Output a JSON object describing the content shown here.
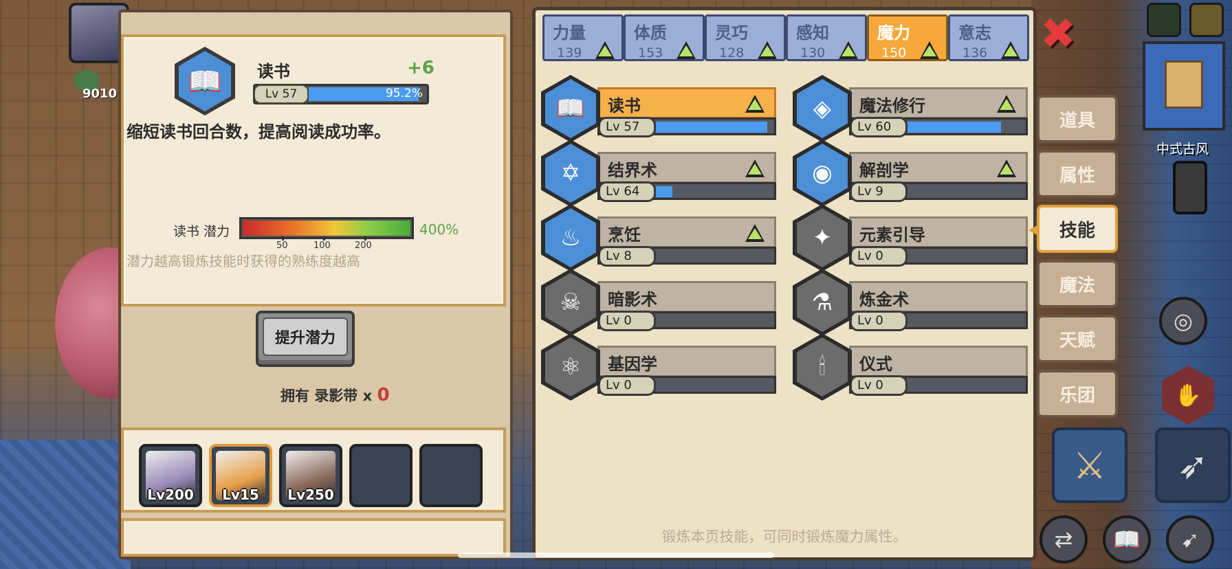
{
  "top_hud": {
    "gem_value": "9010"
  },
  "detail": {
    "skill_name": "读书",
    "bonus": "+6",
    "level_label": "Lv 57",
    "progress_text": "95.2%",
    "progress_value": 0.952,
    "description": "缩短读书回合数，提高阅读成功率。",
    "potential_label": "读书 潜力",
    "potential_value": "400%",
    "potential_ticks": [
      "50",
      "100",
      "200"
    ],
    "potential_hint": "潜力越高锻炼技能时获得的熟练度越高",
    "raise_button": "提升潜力",
    "own_label": "拥有 录影带 x",
    "own_count": "0"
  },
  "party": [
    {
      "level": "Lv200",
      "color": "#9a8ab8",
      "selected": false
    },
    {
      "level": "Lv15",
      "color": "#e8a04a",
      "selected": true
    },
    {
      "level": "Lv250",
      "color": "#8a6a5a",
      "selected": false
    },
    {
      "level": "",
      "color": "",
      "selected": false
    },
    {
      "level": "",
      "color": "",
      "selected": false
    }
  ],
  "attribute_tabs": [
    {
      "name": "力量",
      "value": "139",
      "active": false
    },
    {
      "name": "体质",
      "value": "153",
      "active": false
    },
    {
      "name": "灵巧",
      "value": "128",
      "active": false
    },
    {
      "name": "感知",
      "value": "130",
      "active": false
    },
    {
      "name": "魔力",
      "value": "150",
      "active": true
    },
    {
      "name": "意志",
      "value": "136",
      "active": false
    }
  ],
  "skills": [
    {
      "name": "读书",
      "level": "Lv 57",
      "progress": 0.95,
      "upgrade": true,
      "active": true,
      "icon": "book-icon",
      "glyph": "📖",
      "color": "blue"
    },
    {
      "name": "魔法修行",
      "level": "Lv 60",
      "progress": 0.8,
      "upgrade": true,
      "active": false,
      "icon": "magic-training-icon",
      "glyph": "◈",
      "color": "blue"
    },
    {
      "name": "结界术",
      "level": "Lv 64",
      "progress": 0.14,
      "upgrade": true,
      "active": false,
      "icon": "hexagram-icon",
      "glyph": "✡",
      "color": "blue"
    },
    {
      "name": "解剖学",
      "level": "Lv 9",
      "progress": 0,
      "upgrade": true,
      "active": false,
      "icon": "meat-icon",
      "glyph": "◉",
      "color": "blue"
    },
    {
      "name": "烹饪",
      "level": "Lv 8",
      "progress": 0,
      "upgrade": true,
      "active": false,
      "icon": "pot-icon",
      "glyph": "♨",
      "color": "blue"
    },
    {
      "name": "元素引导",
      "level": "Lv 0",
      "progress": 0,
      "upgrade": false,
      "active": false,
      "icon": "element-icon",
      "glyph": "✦",
      "color": "grey"
    },
    {
      "name": "暗影术",
      "level": "Lv 0",
      "progress": 0,
      "upgrade": false,
      "active": false,
      "icon": "skull-flame-icon",
      "glyph": "☠",
      "color": "grey"
    },
    {
      "name": "炼金术",
      "level": "Lv 0",
      "progress": 0,
      "upgrade": false,
      "active": false,
      "icon": "flask-icon",
      "glyph": "⚗",
      "color": "grey"
    },
    {
      "name": "基因学",
      "level": "Lv 0",
      "progress": 0,
      "upgrade": false,
      "active": false,
      "icon": "molecule-icon",
      "glyph": "⚛",
      "color": "grey"
    },
    {
      "name": "仪式",
      "level": "Lv 0",
      "progress": 0,
      "upgrade": false,
      "active": false,
      "icon": "candle-icon",
      "glyph": "🕯",
      "color": "grey"
    }
  ],
  "panel_footer": "锻炼本页技能，可同时锻炼魔力属性。",
  "side_tabs": [
    {
      "label": "道具",
      "active": false
    },
    {
      "label": "属性",
      "active": false
    },
    {
      "label": "技能",
      "active": true
    },
    {
      "label": "魔法",
      "active": false
    },
    {
      "label": "天赋",
      "active": false
    },
    {
      "label": "乐团",
      "active": false
    }
  ],
  "map": {
    "name": "中式古风"
  },
  "close_glyph": "✖",
  "colors": {
    "accent_orange": "#f7a83a",
    "skill_blue": "#4d8fd6",
    "progress_blue": "#4b9cf0",
    "bonus_green": "#5fa24a",
    "close_red": "#e23b3b"
  }
}
